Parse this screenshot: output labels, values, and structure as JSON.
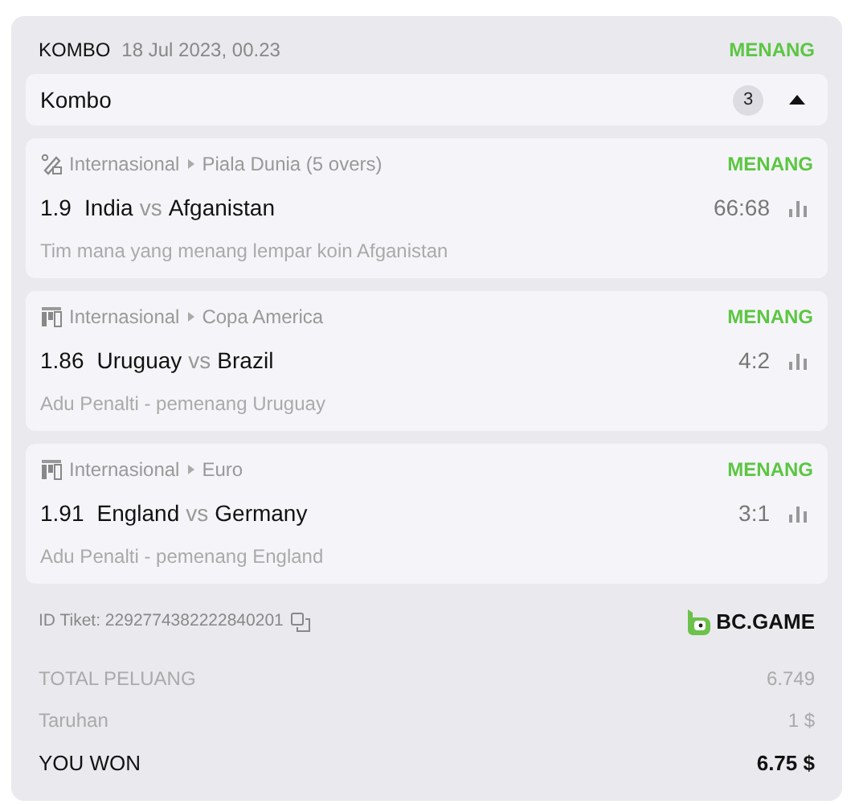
{
  "header": {
    "type": "KOMBO",
    "date": "18 Jul 2023, 00.23",
    "status": "MENANG"
  },
  "combo_bar": {
    "label": "Kombo",
    "count": "3",
    "expanded": true
  },
  "legs": [
    {
      "kind": "cricket",
      "category": "Internasional",
      "league": "Piala Dunia (5 overs)",
      "status": "MENANG",
      "odds": "1.9",
      "home": "India",
      "vs": "vs",
      "away": "Afganistan",
      "score": "66:68",
      "market": "Tim mana yang menang lempar koin Afganistan"
    },
    {
      "kind": "esoccer",
      "category": "Internasional",
      "league": "Copa America",
      "status": "MENANG",
      "odds": "1.86",
      "home": "Uruguay",
      "vs": "vs",
      "away": "Brazil",
      "score": "4:2",
      "market": "Adu Penalti - pemenang Uruguay"
    },
    {
      "kind": "esoccer",
      "category": "Internasional",
      "league": "Euro",
      "status": "MENANG",
      "odds": "1.91",
      "home": "England",
      "vs": "vs",
      "away": "Germany",
      "score": "3:1",
      "market": "Adu Penalti - pemenang England"
    }
  ],
  "ticket": {
    "id_label": "ID Tiket: 2292774382222840201",
    "brand": "BC.GAME"
  },
  "totals": [
    {
      "kind": "muted",
      "label": "TOTAL PELUANG",
      "value": "6.749"
    },
    {
      "kind": "muted",
      "label": "Taruhan",
      "value": "1 $"
    },
    {
      "kind": "strong",
      "label": "YOU WON",
      "value": "6.75 $"
    }
  ]
}
